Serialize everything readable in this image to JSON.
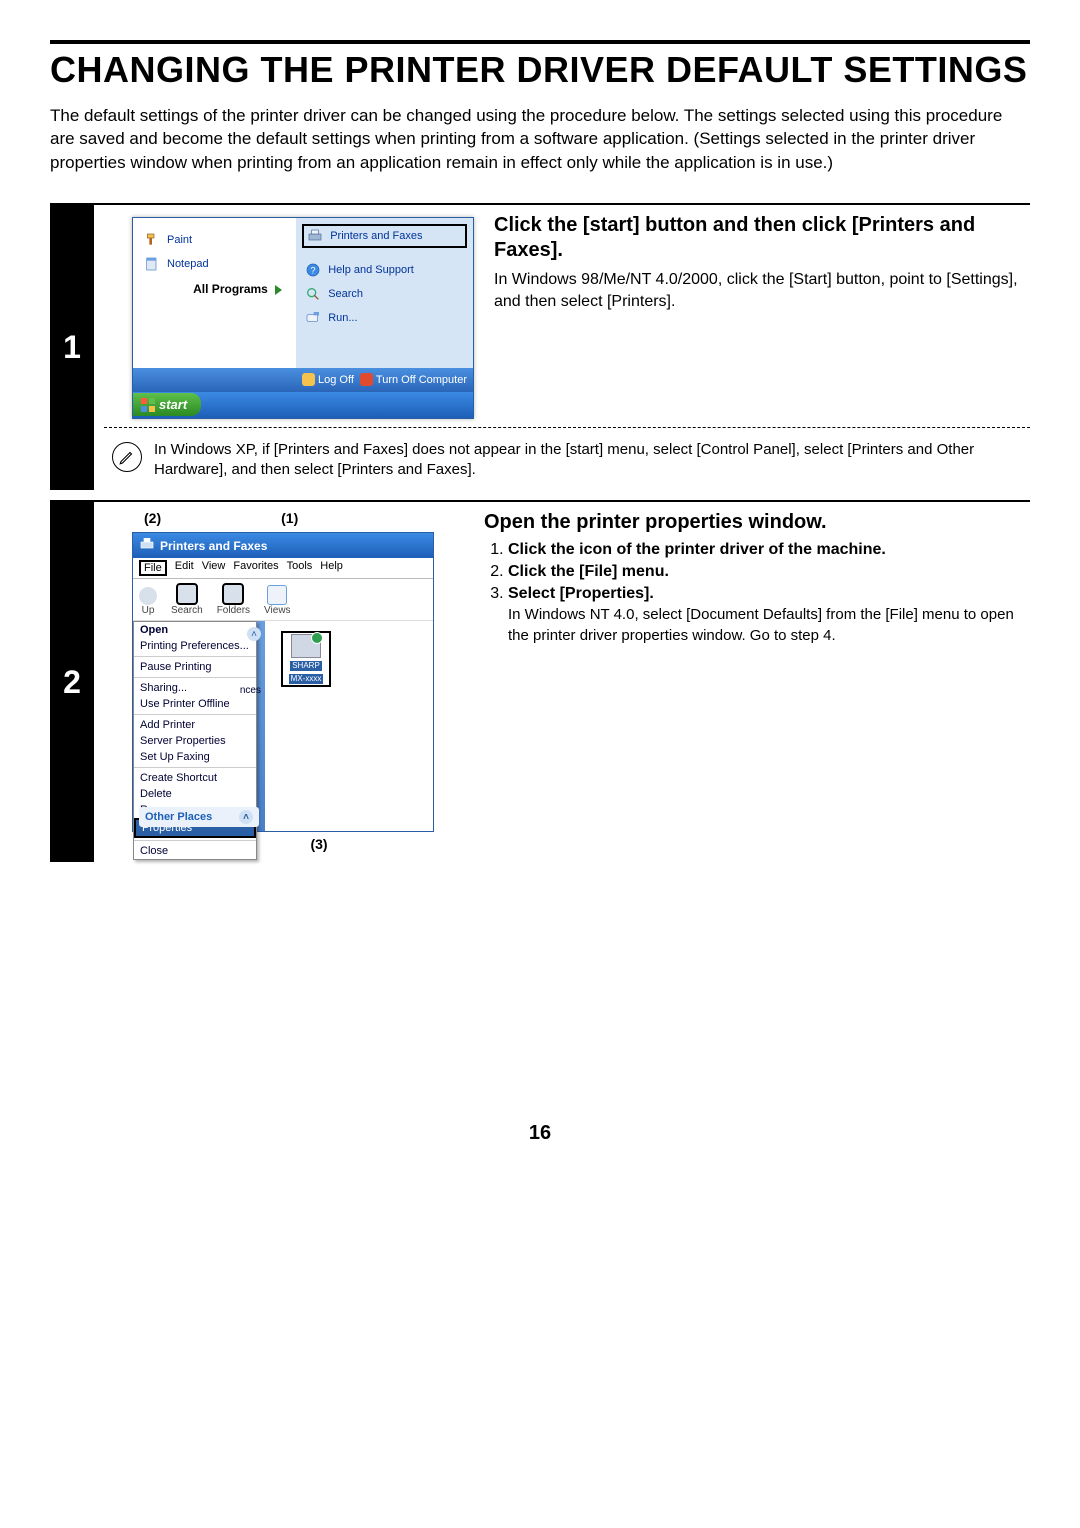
{
  "page": {
    "title": "CHANGING THE PRINTER DRIVER DEFAULT SETTINGS",
    "intro": "The default settings of the printer driver can be changed using the procedure below. The settings selected using this procedure are saved and become the default settings when printing from a software application. (Settings selected in the printer driver properties window when printing from an application remain in effect only while the application is in use.)",
    "page_number": "16"
  },
  "step1": {
    "num": "1",
    "heading": "Click the [start] button and then click [Printers and Faxes].",
    "sub": "In Windows 98/Me/NT 4.0/2000, click the [Start] button, point to [Settings], and then select [Printers].",
    "note": "In Windows XP, if [Printers and Faxes] does not appear in the [start] menu, select [Control Panel], select [Printers and Other Hardware], and then select [Printers and Faxes].",
    "startmenu": {
      "left": {
        "paint": "Paint",
        "notepad": "Notepad",
        "all_programs": "All Programs"
      },
      "right": {
        "printers_faxes": "Printers and Faxes",
        "help_support": "Help and Support",
        "search": "Search",
        "run": "Run..."
      },
      "footer": {
        "log_off": "Log Off",
        "turn_off": "Turn Off Computer"
      },
      "start_label": "start"
    }
  },
  "step2": {
    "num": "2",
    "heading": "Open the printer properties window.",
    "callouts": {
      "c1": "(1)",
      "c2": "(2)",
      "c3": "(3)"
    },
    "items": [
      {
        "label": "Click the icon of the printer driver of the machine."
      },
      {
        "label": "Click the [File] menu."
      },
      {
        "label": "Select [Properties].",
        "note": "In Windows NT 4.0, select [Document Defaults] from the [File] menu to open the printer driver properties window. Go to step 4."
      }
    ],
    "window": {
      "title": "Printers and Faxes",
      "menus": {
        "file": "File",
        "edit": "Edit",
        "view": "View",
        "favorites": "Favorites",
        "tools": "Tools",
        "help": "Help"
      },
      "toolbar": {
        "up": "Up",
        "search": "Search",
        "folders": "Folders",
        "views": "Views"
      },
      "file_menu": {
        "open": "Open",
        "printing_prefs": "Printing Preferences...",
        "pause": "Pause Printing",
        "sharing": "Sharing...",
        "offline": "Use Printer Offline",
        "add_printer": "Add Printer",
        "server_props": "Server Properties",
        "setup_fax": "Set Up Faxing",
        "create_shortcut": "Create Shortcut",
        "delete": "Delete",
        "rename": "Rename",
        "properties": "Properties",
        "close": "Close"
      },
      "side_other": "Other Places",
      "side_chip_suffix": "nces",
      "printer_label_top": "SHARP",
      "printer_label_bottom": "MX-xxxx"
    }
  }
}
